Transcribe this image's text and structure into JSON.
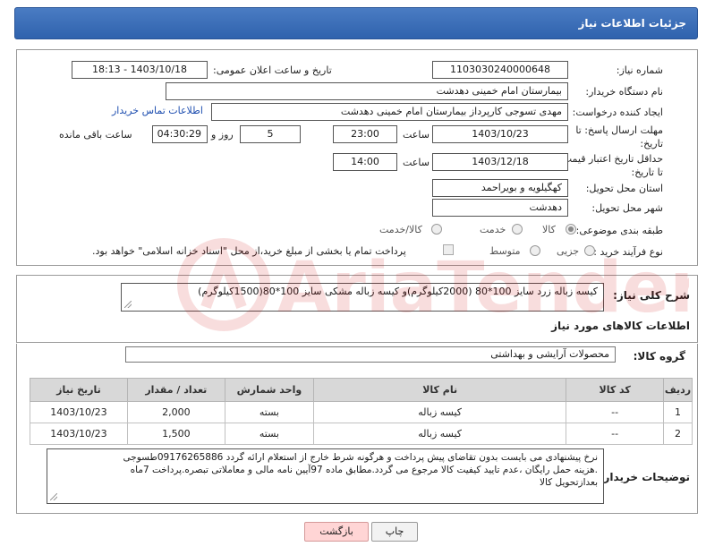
{
  "header": {
    "title": "جزئیات اطلاعات نیاز"
  },
  "form": {
    "need_number_label": "شماره نیاز:",
    "need_number": "1103030240000648",
    "announce_label": "تاریخ و ساعت اعلان عمومی:",
    "announce_value": "1403/10/18 - 18:13",
    "buyer_org_label": "نام دستگاه خریدار:",
    "buyer_org": "بیمارستان امام خمینی دهدشت",
    "requester_label": "ایجاد کننده درخواست:",
    "requester": "مهدی تسوجی کارپرداز بیمارستان امام خمینی دهدشت",
    "buyer_contact_link": "اطلاعات تماس خریدار",
    "deadline_label": "مهلت ارسال پاسخ: تا تاریخ:",
    "deadline_date": "1403/10/23",
    "time_word": "ساعت",
    "deadline_time": "23:00",
    "days_value": "5",
    "days_and_label": "روز و",
    "remaining_time": "04:30:29",
    "remaining_label": "ساعت باقی مانده",
    "validity_label": "حداقل تاریخ اعتبار قیمت: تا تاریخ:",
    "validity_date": "1403/12/18",
    "validity_time": "14:00",
    "province_label": "استان محل تحویل:",
    "province": "کهگیلویه و بویراحمد",
    "city_label": "شهر محل تحویل:",
    "city": "دهدشت",
    "category_label": "طبقه بندی موضوعی:",
    "category_options": [
      "کالا",
      "خدمت",
      "کالا/خدمت"
    ],
    "category_selected": "کالا",
    "process_label": "نوع فرآیند خرید :",
    "process_options": [
      "جزیی",
      "متوسط"
    ],
    "payment_note": "پرداخت تمام یا بخشی از مبلغ خرید،از محل \"اسناد خزانه اسلامی\" خواهد بود."
  },
  "description": {
    "label": "شرح کلی نیاز:",
    "value": "کیسه زباله زرد سایز 100*80 (2000کیلوگرم)و کیسه زباله مشکی سایز 100*80(1500کیلوگرم)"
  },
  "goods": {
    "section_title": "اطلاعات کالاهای مورد نیاز",
    "group_label": "گروه کالا:",
    "group_value": "محصولات آرایشی و بهداشتی",
    "columns": [
      "ردیف",
      "کد کالا",
      "نام کالا",
      "واحد شمارش",
      "تعداد / مقدار",
      "تاریخ نیاز"
    ],
    "rows": [
      {
        "row": "1",
        "code": "--",
        "name": "کیسه زباله",
        "unit": "بسته",
        "qty": "2,000",
        "date": "1403/10/23"
      },
      {
        "row": "2",
        "code": "--",
        "name": "کیسه زباله",
        "unit": "بسته",
        "qty": "1,500",
        "date": "1403/10/23"
      }
    ]
  },
  "buyer_notes": {
    "label": "توضیحات خریدار:",
    "lines": [
      "نرخ پیشنهادی می بایست بدون تقاضای پیش پرداخت و هرگونه شرط خارج از استعلام ارائه گردد 09176265886طسوجی",
      ".هزینه حمل رایگان ،عدم تایید کیفیت کالا مرجوع می گردد.مطابق ماده 97آیین نامه مالی و معاملاتی تبصره.پرداخت 7ماه",
      "بعدازتحویل کالا"
    ]
  },
  "buttons": {
    "back": "بازگشت",
    "print": "چاپ"
  },
  "watermark": {
    "text": "AriaTender.neT"
  },
  "colors": {
    "header": "#2f62ad",
    "back_button": "#ffd5d5",
    "link": "#1f4fb0"
  }
}
